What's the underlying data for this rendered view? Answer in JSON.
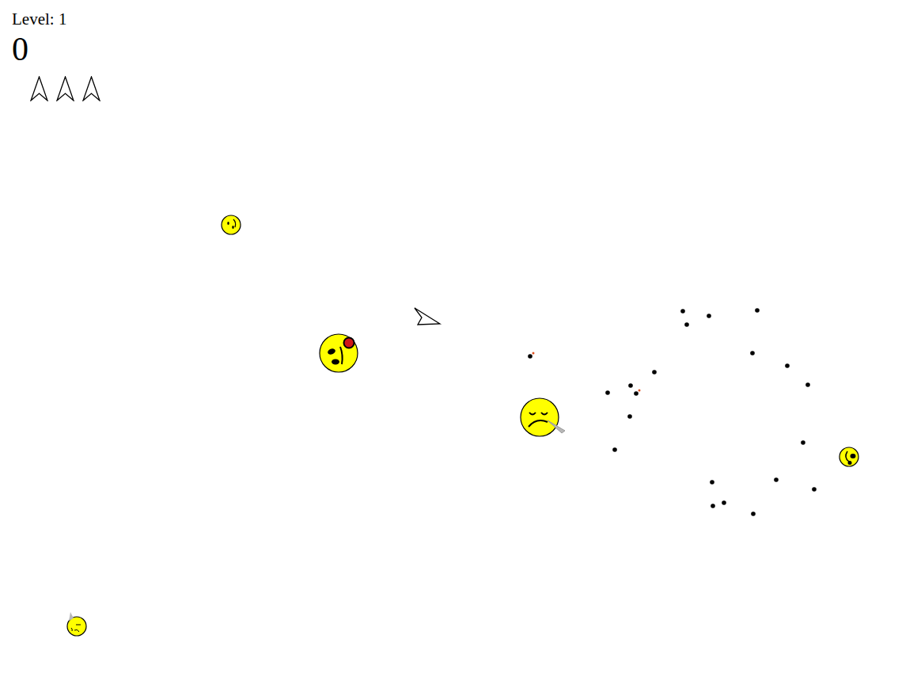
{
  "hud": {
    "level_label": "Level: 1",
    "score": "0",
    "lives": 3
  },
  "enemies": [
    {
      "kind": "worried"
    },
    {
      "kind": "bleeding"
    },
    {
      "kind": "knife"
    },
    {
      "kind": "bruised"
    },
    {
      "kind": "horned"
    }
  ]
}
